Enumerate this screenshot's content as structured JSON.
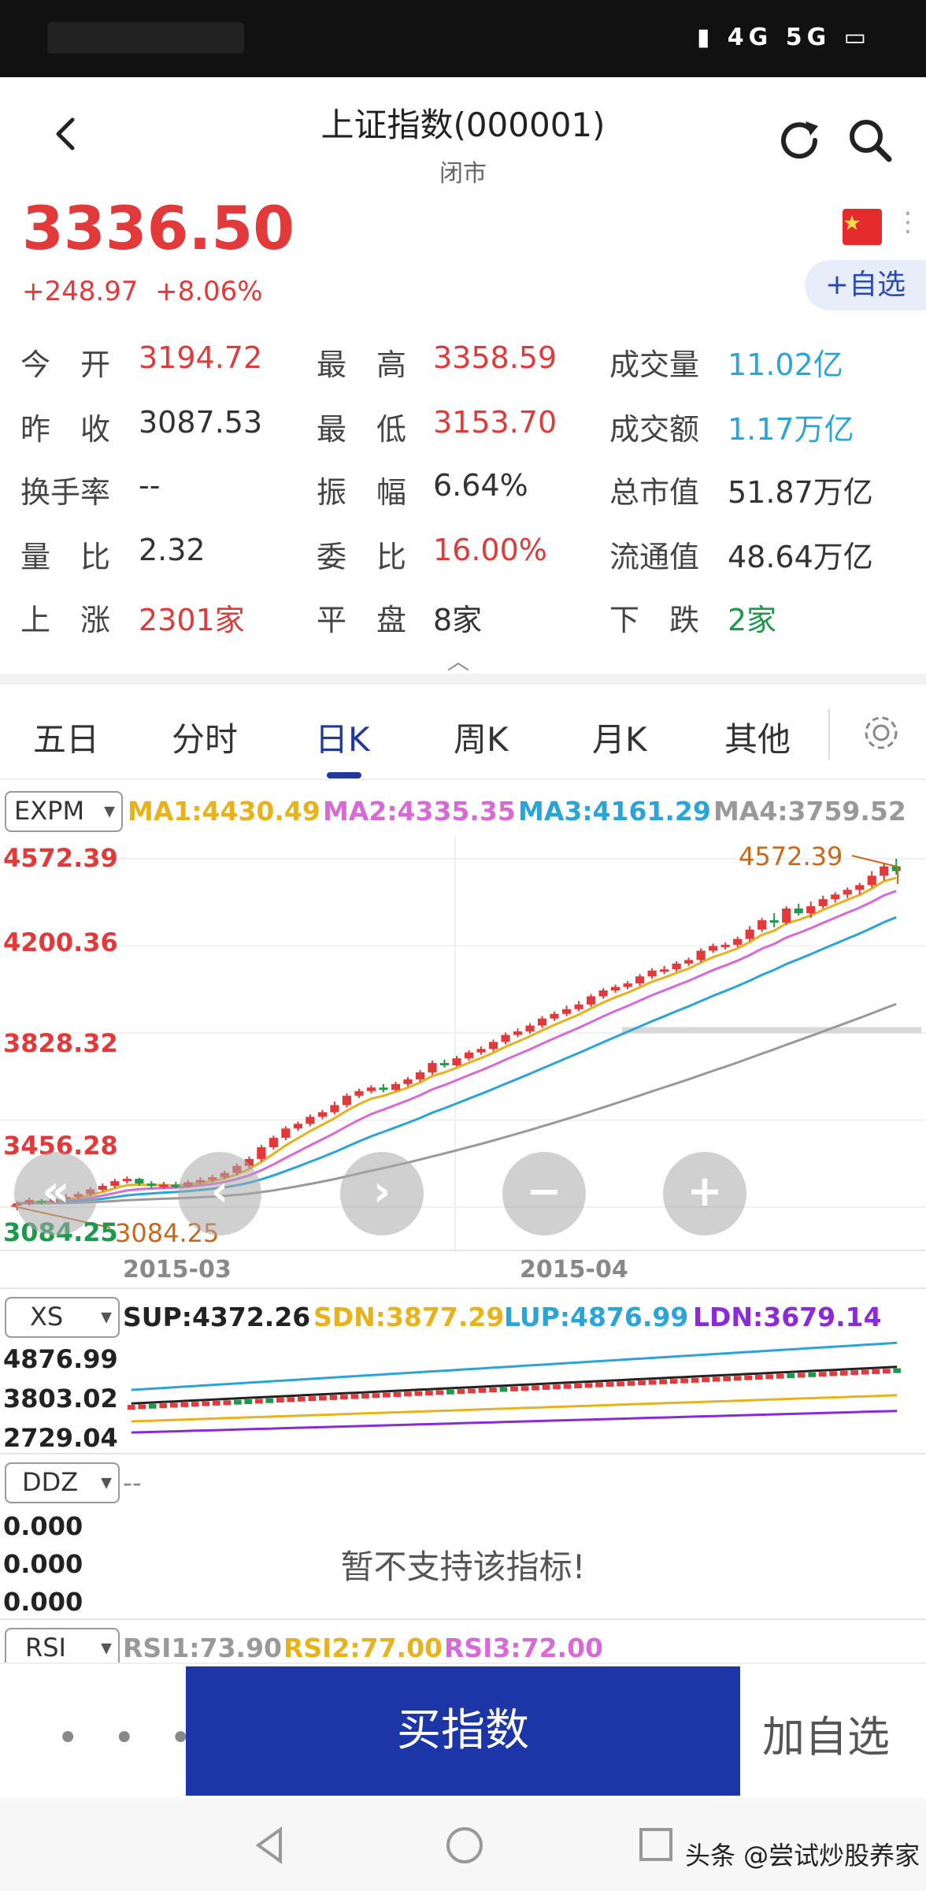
{
  "header": {
    "title": "上证指数(000001)",
    "subtitle": "闭市"
  },
  "quote": {
    "price": "3336.50",
    "change": "+248.97",
    "change_pct": "+8.06%",
    "fav_label": "+自选"
  },
  "stats": [
    {
      "label": "今　开",
      "value": "3194.72",
      "color": "red"
    },
    {
      "label": "最　高",
      "value": "3358.59",
      "color": "red"
    },
    {
      "label": "成交量",
      "value": "11.02亿",
      "color": "blue"
    },
    {
      "label": "昨　收",
      "value": "3087.53",
      "color": "dark"
    },
    {
      "label": "最　低",
      "value": "3153.70",
      "color": "red"
    },
    {
      "label": "成交额",
      "value": "1.17万亿",
      "color": "blue"
    },
    {
      "label": "换手率",
      "value": "--",
      "color": "dark"
    },
    {
      "label": "振　幅",
      "value": "6.64%",
      "color": "dark"
    },
    {
      "label": "总市值",
      "value": "51.87万亿",
      "color": "dark"
    },
    {
      "label": "量　比",
      "value": "2.32",
      "color": "dark"
    },
    {
      "label": "委　比",
      "value": "16.00%",
      "color": "red"
    },
    {
      "label": "流通值",
      "value": "48.64万亿",
      "color": "dark"
    },
    {
      "label": "上　涨",
      "value": "2301家",
      "color": "red"
    },
    {
      "label": "平　盘",
      "value": "8家",
      "color": "dark"
    },
    {
      "label": "下　跌",
      "value": "2家",
      "color": "green"
    }
  ],
  "tabs": [
    "五日",
    "分时",
    "日K",
    "周K",
    "月K",
    "其他"
  ],
  "active_tab": "日K",
  "main_indicator": {
    "name": "EXPM",
    "ma1": "MA1:4430.49",
    "ma2": "MA2:4335.35",
    "ma3": "MA3:4161.29",
    "ma4": "MA4:3759.52"
  },
  "y_labels": [
    "4572.39",
    "4200.36",
    "3828.32",
    "3456.28",
    "3084.25"
  ],
  "max_label": "4572.39",
  "min_label": "3084.25",
  "x_labels": [
    "2015-03",
    "2015-04"
  ],
  "xs_indicator": {
    "name": "XS",
    "sup": "SUP:4372.26",
    "sdn": "SDN:3877.29",
    "lup": "LUP:4876.99",
    "ldn": "LDN:3679.14",
    "y_labels": [
      "4876.99",
      "3803.02",
      "2729.04"
    ]
  },
  "ddz_indicator": {
    "name": "DDZ",
    "suffix": "--",
    "y_labels": [
      "0.000",
      "0.000",
      "0.000"
    ],
    "message": "暂不支持该指标!"
  },
  "rsi_indicator": {
    "name": "RSI",
    "rsi1": "RSI1:73.90",
    "rsi2": "RSI2:77.00",
    "rsi3": "RSI3:72.00"
  },
  "bottom": {
    "more": "• • •",
    "buy_label": "买指数",
    "add_fav_label": "加自选"
  },
  "watermark": "头条 @尝试炒股养家",
  "colors": {
    "up": "#e23a3a",
    "down": "#1a9a4a",
    "ma1": "#e8b21c",
    "ma2": "#d86ad8",
    "ma3": "#2ba5d8",
    "ma4": "#999999",
    "accent": "#1c36a8"
  },
  "chart_data": {
    "type": "candlestick",
    "x_labels": [
      "2015-03",
      "2015-04"
    ],
    "ylim": [
      3084.25,
      4572.39
    ],
    "candles": [
      [
        3090,
        3100,
        3070,
        3110
      ],
      [
        3100,
        3115,
        3090,
        3125
      ],
      [
        3112,
        3105,
        3095,
        3120
      ],
      [
        3105,
        3120,
        3100,
        3130
      ],
      [
        3120,
        3128,
        3110,
        3140
      ],
      [
        3128,
        3140,
        3120,
        3150
      ],
      [
        3140,
        3160,
        3130,
        3170
      ],
      [
        3158,
        3175,
        3150,
        3185
      ],
      [
        3175,
        3195,
        3165,
        3205
      ],
      [
        3195,
        3205,
        3185,
        3215
      ],
      [
        3205,
        3185,
        3175,
        3210
      ],
      [
        3185,
        3175,
        3165,
        3195
      ],
      [
        3175,
        3180,
        3160,
        3192
      ],
      [
        3180,
        3172,
        3165,
        3192
      ],
      [
        3172,
        3190,
        3168,
        3200
      ],
      [
        3190,
        3200,
        3180,
        3212
      ],
      [
        3200,
        3212,
        3190,
        3222
      ],
      [
        3212,
        3230,
        3205,
        3240
      ],
      [
        3230,
        3260,
        3220,
        3270
      ],
      [
        3260,
        3290,
        3250,
        3300
      ],
      [
        3290,
        3340,
        3280,
        3350
      ],
      [
        3340,
        3380,
        3330,
        3390
      ],
      [
        3380,
        3420,
        3370,
        3430
      ],
      [
        3420,
        3440,
        3410,
        3450
      ],
      [
        3440,
        3470,
        3430,
        3480
      ],
      [
        3470,
        3490,
        3460,
        3500
      ],
      [
        3490,
        3520,
        3480,
        3535
      ],
      [
        3520,
        3560,
        3510,
        3570
      ],
      [
        3560,
        3580,
        3550,
        3590
      ],
      [
        3580,
        3595,
        3570,
        3605
      ],
      [
        3595,
        3585,
        3575,
        3610
      ],
      [
        3585,
        3610,
        3580,
        3620
      ],
      [
        3610,
        3630,
        3600,
        3640
      ],
      [
        3630,
        3660,
        3620,
        3670
      ],
      [
        3660,
        3700,
        3650,
        3710
      ],
      [
        3700,
        3690,
        3680,
        3715
      ],
      [
        3690,
        3720,
        3685,
        3730
      ],
      [
        3720,
        3745,
        3710,
        3755
      ],
      [
        3745,
        3760,
        3735,
        3770
      ],
      [
        3760,
        3790,
        3750,
        3800
      ],
      [
        3790,
        3820,
        3780,
        3830
      ],
      [
        3820,
        3835,
        3810,
        3848
      ],
      [
        3835,
        3860,
        3825,
        3870
      ],
      [
        3860,
        3890,
        3850,
        3900
      ],
      [
        3890,
        3910,
        3880,
        3920
      ],
      [
        3910,
        3930,
        3900,
        3945
      ],
      [
        3930,
        3950,
        3920,
        3965
      ],
      [
        3950,
        3985,
        3940,
        3995
      ],
      [
        3985,
        4010,
        3975,
        4020
      ],
      [
        4010,
        4025,
        4000,
        4035
      ],
      [
        4025,
        4040,
        4015,
        4050
      ],
      [
        4040,
        4070,
        4030,
        4080
      ],
      [
        4070,
        4095,
        4060,
        4105
      ],
      [
        4095,
        4100,
        4080,
        4115
      ],
      [
        4100,
        4125,
        4090,
        4135
      ],
      [
        4125,
        4140,
        4115,
        4150
      ],
      [
        4140,
        4180,
        4130,
        4190
      ],
      [
        4180,
        4200,
        4170,
        4210
      ],
      [
        4200,
        4205,
        4185,
        4215
      ],
      [
        4205,
        4230,
        4195,
        4240
      ],
      [
        4230,
        4270,
        4220,
        4285
      ],
      [
        4270,
        4310,
        4260,
        4320
      ],
      [
        4310,
        4300,
        4280,
        4340
      ],
      [
        4300,
        4360,
        4290,
        4370
      ],
      [
        4360,
        4340,
        4330,
        4380
      ],
      [
        4340,
        4370,
        4320,
        4390
      ],
      [
        4370,
        4400,
        4360,
        4415
      ],
      [
        4400,
        4420,
        4385,
        4430
      ],
      [
        4420,
        4440,
        4405,
        4450
      ],
      [
        4440,
        4460,
        4420,
        4470
      ],
      [
        4460,
        4500,
        4450,
        4520
      ],
      [
        4500,
        4540,
        4480,
        4555
      ],
      [
        4540,
        4520,
        4505,
        4572.39
      ]
    ]
  }
}
